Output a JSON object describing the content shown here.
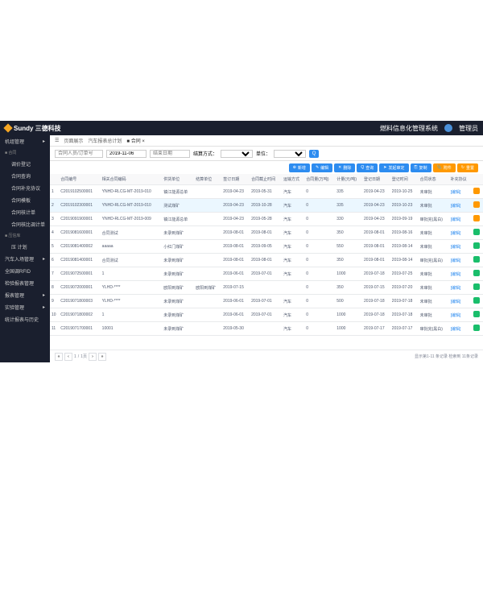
{
  "brand": {
    "name": "Sundy 三德科技"
  },
  "system": {
    "title": "燃料信息化管理系统",
    "user": "管理员"
  },
  "breadcrumb": {
    "items": [
      "页面展示",
      "汽车报表总计划",
      "合同"
    ],
    "home": "⌂"
  },
  "sidebar": {
    "top": "机组管理",
    "groups": [
      {
        "label": "■ 合同",
        "items": [
          {
            "label": "调价登记"
          },
          {
            "label": "合同查询"
          },
          {
            "label": "合同补充协议"
          },
          {
            "label": "合同模板"
          },
          {
            "label": "合同核计单"
          },
          {
            "label": "合同核比调计单"
          }
        ]
      },
      {
        "label": "■ 压信库",
        "items": [
          {
            "label": "压 计划"
          }
        ]
      },
      {
        "label": "汽车入场管理"
      },
      {
        "label": "全国调RFID"
      },
      {
        "label": "检验报表管理"
      },
      {
        "label": "报表管理"
      },
      {
        "label": "实验管理"
      },
      {
        "label": "统计报表与历史"
      }
    ]
  },
  "filters": {
    "input1_ph": "合同人员/订单号",
    "date": "2019-11-06",
    "input2_ph": "结束日期",
    "sel1_label": "结算方式：",
    "sel2_label": "单位："
  },
  "toolbar": {
    "add": "新增",
    "edit": "编辑",
    "del": "删除",
    "query": "查询",
    "send": "发起审定",
    "copy": "复制",
    "attach": "附件",
    "refresh": "重置"
  },
  "table": {
    "headers": [
      "",
      "合同编号",
      "相关合同编码",
      "供货单位",
      "结算单位",
      "签订日期",
      "合同截止时间",
      "运输方式",
      "合同量(万吨)",
      "计量(元/吨)",
      "登记日期",
      "登记时间",
      "合同状态",
      "补充协议",
      ""
    ],
    "rows": [
      [
        "1",
        "C2019102500001",
        "YNHD-RLCG-MT-2019-010",
        "镇江能源总单",
        "",
        "2019-04-23",
        "2019-05-31",
        "汽车",
        "0",
        "335",
        "2019-04-23",
        "2019-10-25",
        "未审批",
        "[编辑]",
        "o"
      ],
      [
        "2",
        "C2019102300001",
        "YNHD-RLCG-MT-2019-010",
        "测试煤矿",
        "",
        "2019-04-23",
        "2019-10-28",
        "汽车",
        "0",
        "335",
        "2019-04-23",
        "2019-10-23",
        "未审批",
        "[编辑]",
        "o"
      ],
      [
        "3",
        "C2019091900001",
        "YNHD-RLCG-MT-2019-009",
        "镇江能源总单",
        "",
        "2019-04-23",
        "2019-05-28",
        "汽车",
        "0",
        "330",
        "2019-04-23",
        "2019-09-19",
        "审批完(黑白)",
        "[编辑]",
        "o"
      ],
      [
        "4",
        "C2019081600001",
        "合同测试",
        "未录到煤矿",
        "",
        "2019-08-01",
        "2019-08-01",
        "汽车",
        "0",
        "350",
        "2019-08-01",
        "2019-08-16",
        "未审批",
        "[编辑]",
        "g"
      ],
      [
        "5",
        "C2019081400002",
        "aaaaa",
        "小红门煤矿",
        "",
        "2019-08-01",
        "2019-09-05",
        "汽车",
        "0",
        "550",
        "2019-08-01",
        "2019-08-14",
        "未审批",
        "[编辑]",
        "g"
      ],
      [
        "6",
        "C2019081400001",
        "合同测试",
        "未录到煤矿",
        "",
        "2019-08-01",
        "2019-08-01",
        "汽车",
        "0",
        "350",
        "2019-08-01",
        "2019-08-14",
        "审批完(黑白)",
        "[编辑]",
        "g"
      ],
      [
        "7",
        "C2019072500001",
        "1",
        "未录到煤矿",
        "",
        "2019-06-01",
        "2019-07-01",
        "汽车",
        "0",
        "1000",
        "2019-07-18",
        "2019-07-25",
        "未审批",
        "[编辑]",
        "g"
      ],
      [
        "8",
        "C2019072000001",
        "YLHD-****",
        "欧阳到煤矿",
        "欧阳到煤矿",
        "2019-07-15",
        "",
        "",
        "0",
        "350",
        "2019-07-15",
        "2019-07-20",
        "未审批",
        "[编辑]",
        "g"
      ],
      [
        "9",
        "C2019071800003",
        "YLHD-****",
        "未录到煤矿",
        "",
        "2019-06-01",
        "2019-07-01",
        "汽车",
        "0",
        "500",
        "2019-07-18",
        "2019-07-18",
        "未审批",
        "[编辑]",
        "g"
      ],
      [
        "10",
        "C2019071800002",
        "1",
        "未录到煤矿",
        "",
        "2019-06-01",
        "2019-07-01",
        "汽车",
        "0",
        "1000",
        "2019-07-18",
        "2019-07-18",
        "未审批",
        "[编辑]",
        "g"
      ],
      [
        "11",
        "C2019071700001",
        "10001",
        "未录到煤矿",
        "",
        "2019-05-30",
        "",
        "汽车",
        "0",
        "1000",
        "2019-07-17",
        "2019-07-17",
        "审批完(黑白)",
        "[编辑]",
        "g"
      ]
    ]
  },
  "footer": {
    "page": "1",
    "sep": "/",
    "total": "1页",
    "info": "显示第1-11 条记录  检索到 11条记录"
  }
}
